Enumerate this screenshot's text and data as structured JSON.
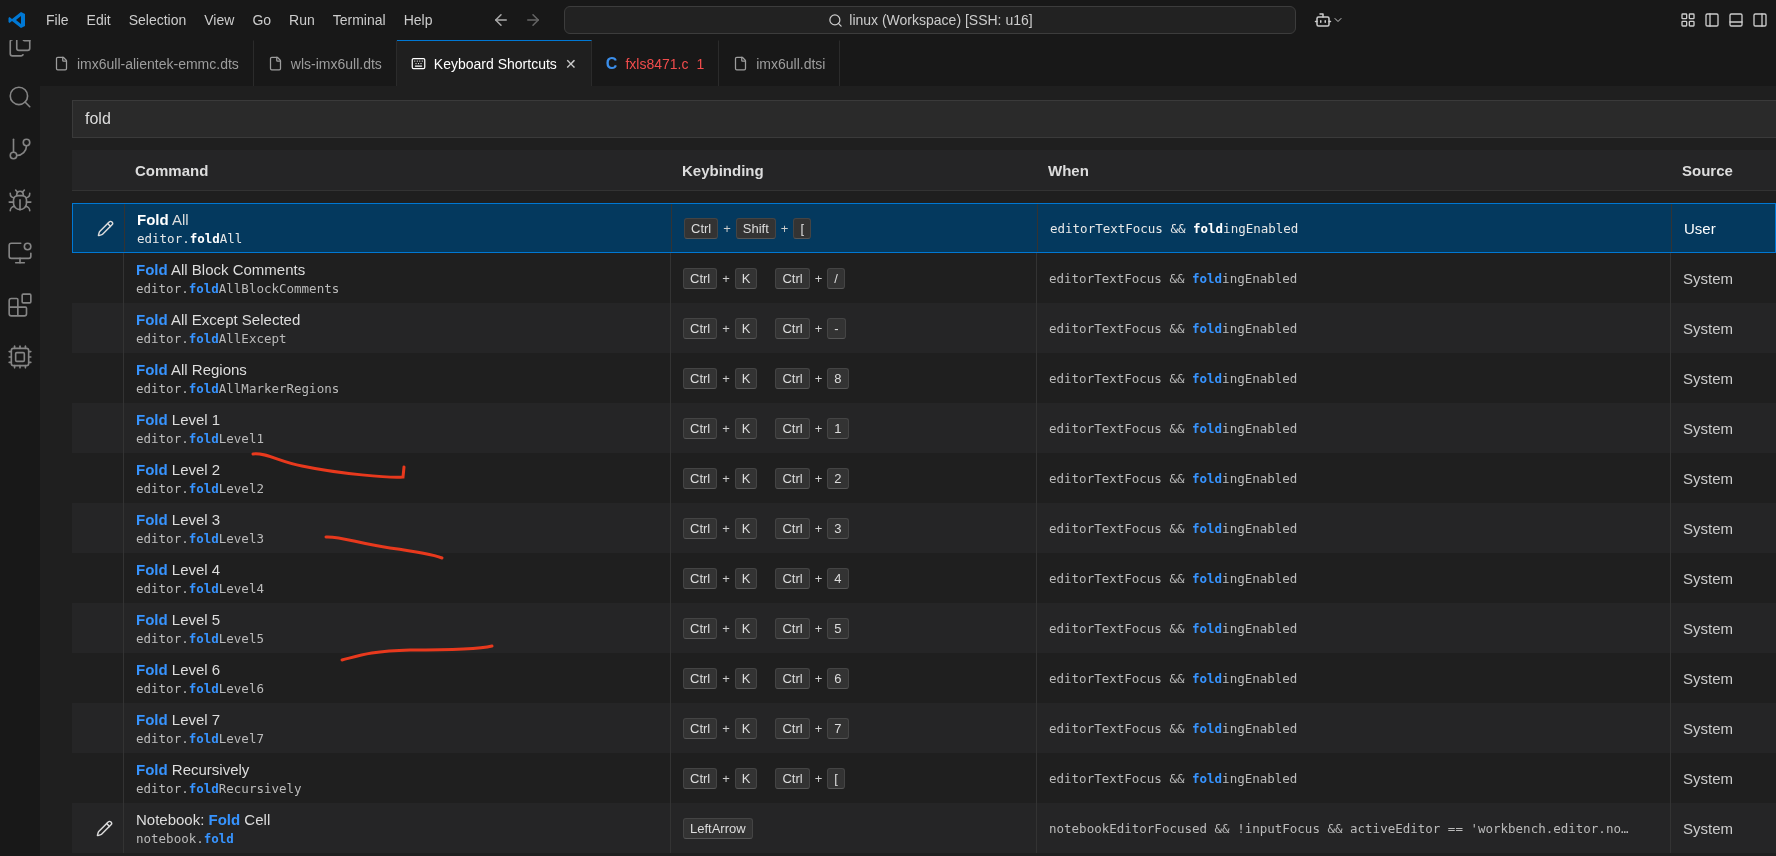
{
  "menu": [
    "File",
    "Edit",
    "Selection",
    "View",
    "Go",
    "Run",
    "Terminal",
    "Help"
  ],
  "command_center": "linux (Workspace) [SSH: u16]",
  "tabs": [
    {
      "label": "imx6ull-alientek-emmc.dts",
      "kind": "file",
      "selected": false,
      "error": false
    },
    {
      "label": "wls-imx6ull.dts",
      "kind": "file",
      "selected": false,
      "error": false
    },
    {
      "label": "Keyboard Shortcuts",
      "kind": "keyboard",
      "selected": true,
      "error": false,
      "close": "✕"
    },
    {
      "label": "fxls8471.c",
      "kind": "c",
      "icon_text": "C",
      "selected": false,
      "error": true,
      "problems": "1"
    },
    {
      "label": "imx6ull.dtsi",
      "kind": "file",
      "selected": false,
      "error": false
    }
  ],
  "search": {
    "value": "fold"
  },
  "table": {
    "columns": [
      "Command",
      "Keybinding",
      "When",
      "Source"
    ],
    "rows": [
      {
        "title": "**Fold** All",
        "command": "editor.**fold**All",
        "keys": [
          [
            "Ctrl",
            "Shift",
            "["
          ]
        ],
        "when": "editorTextFocus && **fold**ingEnabled",
        "source": "User",
        "selected": true,
        "edit_icon": true
      },
      {
        "title": "**Fold** All Block Comments",
        "command": "editor.**fold**AllBlockComments",
        "keys": [
          [
            "Ctrl",
            "K"
          ],
          [
            "Ctrl",
            "/"
          ]
        ],
        "when": "editorTextFocus && **fold**ingEnabled",
        "source": "System",
        "selected": false,
        "edit_icon": false
      },
      {
        "title": "**Fold** All Except Selected",
        "command": "editor.**fold**AllExcept",
        "keys": [
          [
            "Ctrl",
            "K"
          ],
          [
            "Ctrl",
            "-"
          ]
        ],
        "when": "editorTextFocus && **fold**ingEnabled",
        "source": "System",
        "selected": false,
        "edit_icon": false
      },
      {
        "title": "**Fold** All Regions",
        "command": "editor.**fold**AllMarkerRegions",
        "keys": [
          [
            "Ctrl",
            "K"
          ],
          [
            "Ctrl",
            "8"
          ]
        ],
        "when": "editorTextFocus && **fold**ingEnabled",
        "source": "System",
        "selected": false,
        "edit_icon": false
      },
      {
        "title": "**Fold** Level 1",
        "command": "editor.**fold**Level1",
        "keys": [
          [
            "Ctrl",
            "K"
          ],
          [
            "Ctrl",
            "1"
          ]
        ],
        "when": "editorTextFocus && **fold**ingEnabled",
        "source": "System",
        "selected": false,
        "edit_icon": false
      },
      {
        "title": "**Fold** Level 2",
        "command": "editor.**fold**Level2",
        "keys": [
          [
            "Ctrl",
            "K"
          ],
          [
            "Ctrl",
            "2"
          ]
        ],
        "when": "editorTextFocus && **fold**ingEnabled",
        "source": "System",
        "selected": false,
        "edit_icon": false
      },
      {
        "title": "**Fold** Level 3",
        "command": "editor.**fold**Level3",
        "keys": [
          [
            "Ctrl",
            "K"
          ],
          [
            "Ctrl",
            "3"
          ]
        ],
        "when": "editorTextFocus && **fold**ingEnabled",
        "source": "System",
        "selected": false,
        "edit_icon": false
      },
      {
        "title": "**Fold** Level 4",
        "command": "editor.**fold**Level4",
        "keys": [
          [
            "Ctrl",
            "K"
          ],
          [
            "Ctrl",
            "4"
          ]
        ],
        "when": "editorTextFocus && **fold**ingEnabled",
        "source": "System",
        "selected": false,
        "edit_icon": false
      },
      {
        "title": "**Fold** Level 5",
        "command": "editor.**fold**Level5",
        "keys": [
          [
            "Ctrl",
            "K"
          ],
          [
            "Ctrl",
            "5"
          ]
        ],
        "when": "editorTextFocus && **fold**ingEnabled",
        "source": "System",
        "selected": false,
        "edit_icon": false
      },
      {
        "title": "**Fold** Level 6",
        "command": "editor.**fold**Level6",
        "keys": [
          [
            "Ctrl",
            "K"
          ],
          [
            "Ctrl",
            "6"
          ]
        ],
        "when": "editorTextFocus && **fold**ingEnabled",
        "source": "System",
        "selected": false,
        "edit_icon": false
      },
      {
        "title": "**Fold** Level 7",
        "command": "editor.**fold**Level7",
        "keys": [
          [
            "Ctrl",
            "K"
          ],
          [
            "Ctrl",
            "7"
          ]
        ],
        "when": "editorTextFocus && **fold**ingEnabled",
        "source": "System",
        "selected": false,
        "edit_icon": false
      },
      {
        "title": "**Fold** Recursively",
        "command": "editor.**fold**Recursively",
        "keys": [
          [
            "Ctrl",
            "K"
          ],
          [
            "Ctrl",
            "["
          ]
        ],
        "when": "editorTextFocus && **fold**ingEnabled",
        "source": "System",
        "selected": false,
        "edit_icon": false
      },
      {
        "title": "Notebook: **Fold** Cell",
        "command": "notebook.**fold**",
        "keys": [
          [
            "LeftArrow"
          ]
        ],
        "when": "notebookEditorFocused && !inputFocus && activeEditor == 'workbench.editor.no…",
        "source": "System",
        "selected": false,
        "edit_icon": true
      }
    ]
  },
  "key_joiner": "+"
}
